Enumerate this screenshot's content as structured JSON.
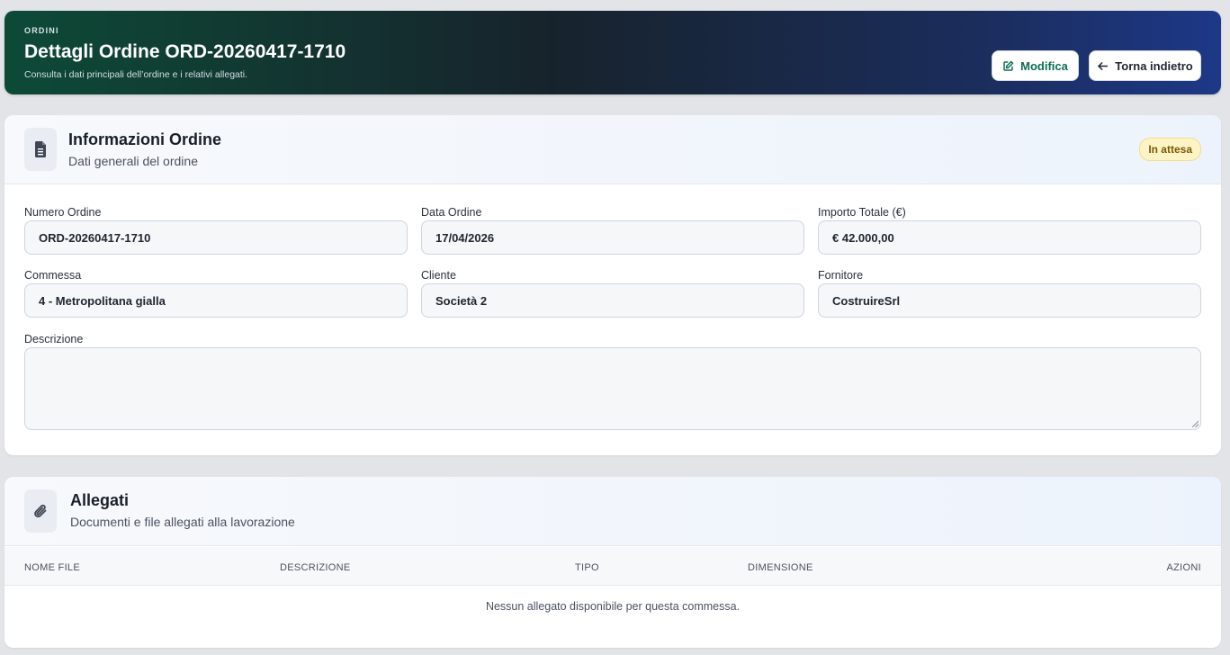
{
  "header": {
    "eyebrow": "ORDINI",
    "title": "Dettagli Ordine ORD-20260417-1710",
    "subtitle": "Consulta i dati principali dell’ordine e i relativi allegati.",
    "edit_label": "Modifica",
    "back_label": "Torna indietro"
  },
  "info_card": {
    "title": "Informazioni Ordine",
    "subtitle": "Dati generali del ordine",
    "status": "In attesa",
    "fields": [
      {
        "label": "Numero Ordine",
        "value": "ORD-20260417-1710"
      },
      {
        "label": "Data Ordine",
        "value": "17/04/2026"
      },
      {
        "label": "Importo Totale (€)",
        "value": "€ 42.000,00"
      },
      {
        "label": "Commessa",
        "value": "4 - Metropolitana gialla"
      },
      {
        "label": "Cliente",
        "value": "Società 2"
      },
      {
        "label": "Fornitore",
        "value": "CostruireSrl"
      }
    ],
    "description_label": "Descrizione",
    "description_value": ""
  },
  "attachments_card": {
    "title": "Allegati",
    "subtitle": "Documenti e file allegati alla lavorazione",
    "columns": [
      "NOME FILE",
      "DESCRIZIONE",
      "TIPO",
      "DIMENSIONE",
      "AZIONI"
    ],
    "empty_message": "Nessun allegato disponibile per questa commessa."
  },
  "icons": {
    "edit": "edit-icon",
    "back": "arrow-left-icon",
    "document": "document-icon",
    "attachment": "paperclip-icon"
  },
  "colors": {
    "accent_green": "#0d6e4e",
    "header_start": "#0d4a36",
    "header_end": "#1d3887",
    "badge_bg": "#fdf3c4"
  }
}
